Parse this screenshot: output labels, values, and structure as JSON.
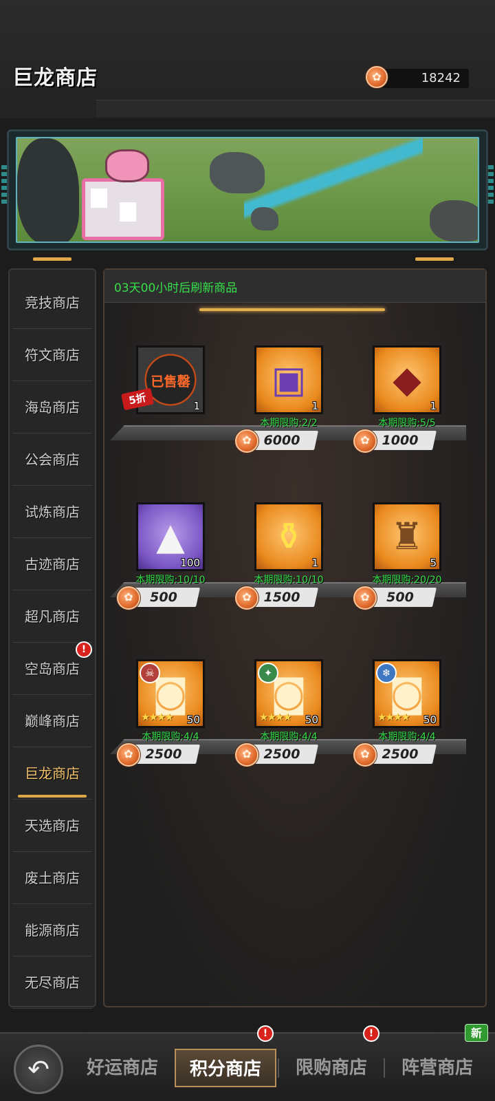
{
  "header": {
    "title": "巨龙商店",
    "currency_icon": "dragon-coin-icon",
    "currency_amount": "18242"
  },
  "banner": {
    "description_icon": "pig-bulletin-board"
  },
  "sidebar": {
    "items": [
      {
        "label": "竞技商店",
        "active": false
      },
      {
        "label": "符文商店",
        "active": false
      },
      {
        "label": "海岛商店",
        "active": false
      },
      {
        "label": "公会商店",
        "active": false
      },
      {
        "label": "试炼商店",
        "active": false
      },
      {
        "label": "古迹商店",
        "active": false
      },
      {
        "label": "超凡商店",
        "active": false
      },
      {
        "label": "空岛商店",
        "active": false,
        "badge": "!"
      },
      {
        "label": "巅峰商店",
        "active": false
      },
      {
        "label": "巨龙商店",
        "active": true
      },
      {
        "label": "天选商店",
        "active": false
      },
      {
        "label": "废土商店",
        "active": false
      },
      {
        "label": "能源商店",
        "active": false
      },
      {
        "label": "无尽商店",
        "active": false
      }
    ]
  },
  "shop": {
    "refresh_text": "03天00小时后刷新商品",
    "items": [
      {
        "icon": "sold-out-chest-icon",
        "qty": "1",
        "sold_label": "已售罄",
        "discount": "5折",
        "limit": "",
        "price": ""
      },
      {
        "icon": "treasure-chest-icon",
        "qty": "1",
        "limit": "本期限购:2/2",
        "price": "6000"
      },
      {
        "icon": "dragon-egg-icon",
        "qty": "1",
        "limit": "本期限购:5/5",
        "price": "1000"
      },
      {
        "icon": "dust-pile-icon",
        "qty": "100",
        "limit": "本期限购:10/10",
        "price": "500"
      },
      {
        "icon": "golden-potion-icon",
        "qty": "1",
        "limit": "本期限购:10/10",
        "price": "1500"
      },
      {
        "icon": "goblet-icon",
        "qty": "5",
        "limit": "本期限购:20/20",
        "price": "500"
      },
      {
        "icon": "puzzle-piece-skull-icon",
        "qty": "50",
        "limit": "本期限购:4/4",
        "price": "2500"
      },
      {
        "icon": "puzzle-piece-nature-icon",
        "qty": "50",
        "limit": "本期限购:4/4",
        "price": "2500"
      },
      {
        "icon": "puzzle-piece-frost-icon",
        "qty": "50",
        "limit": "本期限购:4/4",
        "price": "2500"
      }
    ]
  },
  "tabbar": {
    "back_icon": "back-arrow-icon",
    "tabs": [
      {
        "label": "好运商店",
        "active": false
      },
      {
        "label": "积分商店",
        "active": true,
        "badge": "!"
      },
      {
        "label": "限购商店",
        "active": false,
        "badge": "!"
      },
      {
        "label": "阵营商店",
        "active": false,
        "new_badge": "新"
      }
    ]
  },
  "colors": {
    "accent": "#e0a64a",
    "limit_green": "#36e04b",
    "badge_red": "#d8221c"
  }
}
